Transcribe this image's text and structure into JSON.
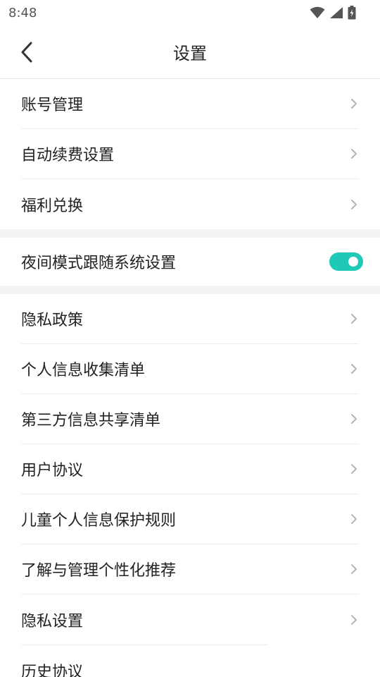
{
  "status_bar": {
    "time": "8:48",
    "icons": [
      "wifi-icon",
      "signal-icon",
      "battery-charging-icon"
    ]
  },
  "header": {
    "back_icon": "chevron-left-icon",
    "title": "设置"
  },
  "sections": [
    {
      "items": [
        {
          "label": "账号管理"
        },
        {
          "label": "自动续费设置"
        },
        {
          "label": "福利兑换"
        }
      ]
    },
    {
      "items": [
        {
          "label": "夜间模式跟随系统设置",
          "toggle": true,
          "toggle_on": true
        }
      ]
    },
    {
      "items": [
        {
          "label": "隐私政策"
        },
        {
          "label": "个人信息收集清单"
        },
        {
          "label": "第三方信息共享清单"
        },
        {
          "label": "用户协议"
        },
        {
          "label": "儿童个人信息保护规则"
        },
        {
          "label": "了解与管理个性化推荐"
        },
        {
          "label": "隐私设置"
        },
        {
          "label": "历史协议"
        }
      ]
    }
  ],
  "colors": {
    "accent": "#1ec9b7",
    "divider": "#ececec",
    "section_gap": "#f3f3f3",
    "chevron": "#b5b5b5"
  }
}
